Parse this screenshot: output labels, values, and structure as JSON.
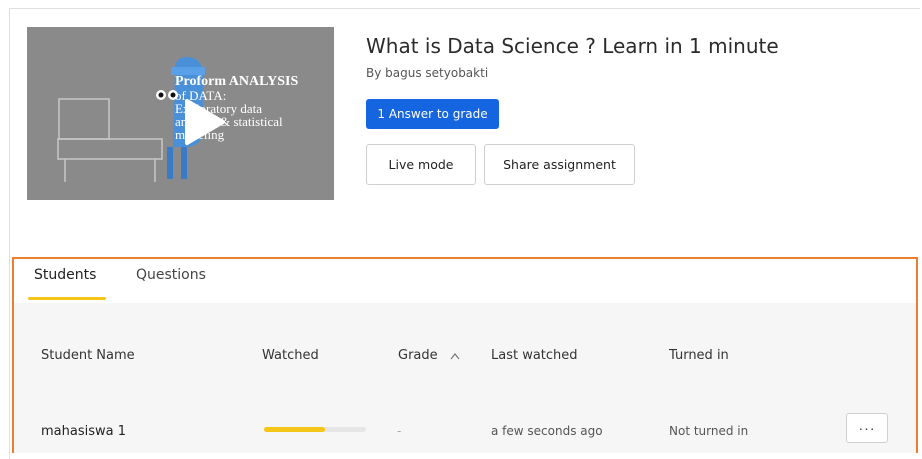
{
  "video": {
    "title": "What is Data Science ? Learn in 1 minute",
    "author": "By bagus setyobakti",
    "thumbnail_text_1": "Proform ANALYSIS",
    "thumbnail_text_2": "of DATA:",
    "thumbnail_text_3": "Exploratory data",
    "thumbnail_text_4": "analysis & statistical",
    "thumbnail_text_5": "modeling"
  },
  "actions": {
    "grade_label": "1 Answer to grade",
    "live_label": "Live mode",
    "share_label": "Share assignment"
  },
  "tabs": [
    {
      "label": "Students",
      "active": true
    },
    {
      "label": "Questions",
      "active": false
    }
  ],
  "table": {
    "headers": [
      "Student Name",
      "Watched",
      "Grade",
      "Last watched",
      "Turned in"
    ],
    "rows": [
      {
        "student_name": "mahasiswa 1",
        "watched_fraction": 0.6,
        "grade": "-",
        "last_watched": "a few seconds ago",
        "turned_in": "Not turned in",
        "more_label": "···"
      }
    ]
  },
  "colors": {
    "primary_button": "#1565e0",
    "tab_underline": "#f5c518",
    "progress_fill": "#f5c518",
    "panel_highlight": "#ec7f2f"
  },
  "icons": {
    "play": "play-icon",
    "sort": "sort-asc-icon",
    "more": "more-icon"
  }
}
